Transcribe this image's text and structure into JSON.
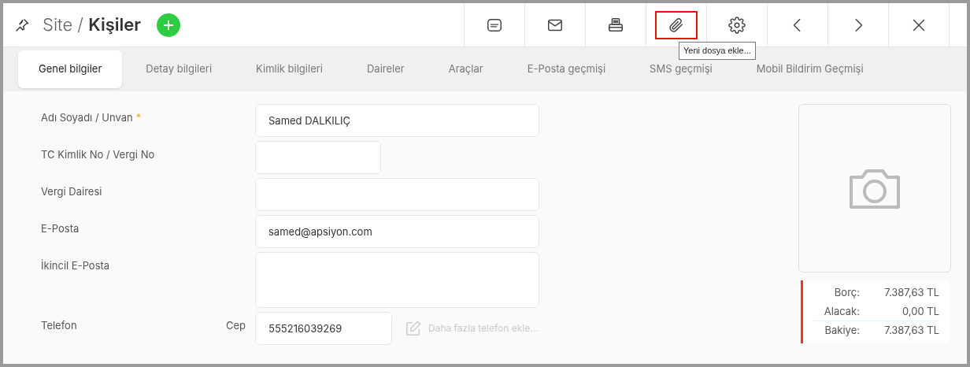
{
  "header": {
    "title_prefix": "Site / ",
    "title": "Kişiler"
  },
  "toolbar": [
    {
      "kind": "sms",
      "highlighted": false
    },
    {
      "kind": "mail",
      "highlighted": false
    },
    {
      "kind": "print",
      "highlighted": false
    },
    {
      "kind": "attach",
      "highlighted": true
    },
    {
      "kind": "settings",
      "highlighted": false
    },
    {
      "kind": "prev",
      "highlighted": false
    },
    {
      "kind": "next",
      "highlighted": false
    },
    {
      "kind": "close",
      "highlighted": false
    }
  ],
  "tooltip": "Yeni dosya ekle...",
  "tabs": [
    {
      "label": "Genel bilgiler",
      "selected": true
    },
    {
      "label": "Detay bilgileri",
      "selected": false
    },
    {
      "label": "Kimlik bilgileri",
      "selected": false
    },
    {
      "label": "Daireler",
      "selected": false
    },
    {
      "label": "Araçlar",
      "selected": false
    },
    {
      "label": "E-Posta geçmişi",
      "selected": false
    },
    {
      "label": "SMS geçmişi",
      "selected": false
    },
    {
      "label": "Mobil Bildirim Geçmişi",
      "selected": false
    }
  ],
  "fields": [
    {
      "kind": "text",
      "label": "Adı Soyadı / Unvan",
      "required_mark": "*",
      "value": "Samed DALKILIÇ"
    },
    {
      "kind": "short",
      "label": "TC Kimlik No / Vergi No"
    },
    {
      "kind": "text",
      "label": "Vergi Dairesi"
    },
    {
      "kind": "text",
      "label": "E-Posta",
      "value": "samed@apsiyon.com"
    },
    {
      "kind": "textarea",
      "label": "İkincil E-Posta"
    },
    {
      "kind": "phone",
      "label": "Telefon",
      "sublabel": "Cep",
      "value": "555216039269",
      "link": "Daha fazla telefon ekle..."
    }
  ],
  "balance": [
    {
      "label": "Borç:",
      "value": "7.387,63 TL"
    },
    {
      "label": "Alacak:",
      "value": "0,00 TL"
    },
    {
      "label": "Bakiye:",
      "value": "7.387,63 TL"
    }
  ]
}
